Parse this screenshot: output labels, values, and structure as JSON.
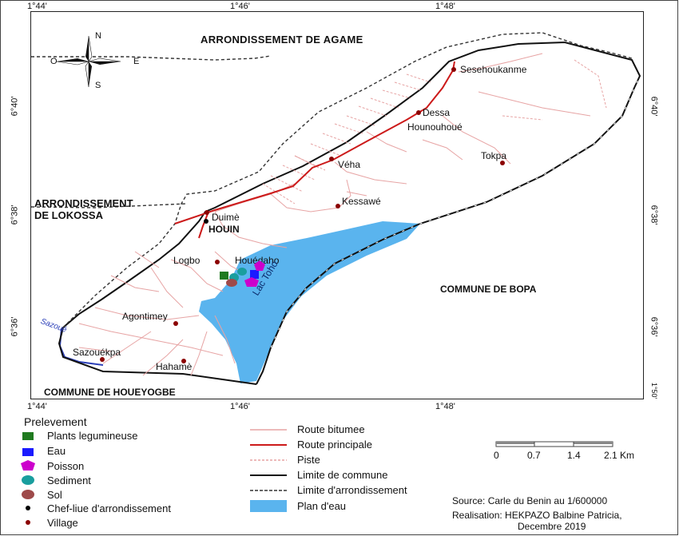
{
  "coords": {
    "top": [
      "1°44'",
      "1°46'",
      "1°48'"
    ],
    "bottom": [
      "1°44'",
      "1°46'",
      "1°48'"
    ],
    "left": [
      "6°40'",
      "6°38'",
      "6°36'"
    ],
    "right": [
      "6°40'",
      "6°38'",
      "6°36'"
    ],
    "corner_right_bottom": "1°50'"
  },
  "compass": {
    "n": "N",
    "s": "S",
    "e": "E",
    "w": "O"
  },
  "regions": {
    "agame": "ARRONDISSEMENT DE AGAME",
    "lokossa_1": "ARRONDISSEMENT",
    "lokossa_2": "DE LOKOSSA",
    "bopa": "COMMUNE DE BOPA",
    "houeyogbe": "COMMUNE DE HOUEYOGBE"
  },
  "places": {
    "sesehoukanme": "Sesehoukanme",
    "dessa": "Dessa",
    "hounouhoue": "Hounouhoué",
    "tokpa": "Tokpa",
    "veha": "Véha",
    "kessawe": "Kessawé",
    "duime": "Duimè",
    "houin": "HOUIN",
    "logbo": "Logbo",
    "houedaho": "Houédaho",
    "agontimey": "Agontimey",
    "sazouekpa": "Sazouékpa",
    "hahame": "Hahamè",
    "lac_toho": "Lac Toho",
    "sazoue": "Sazoué"
  },
  "legend_left": {
    "title": "Prelevement",
    "items": [
      {
        "label": "Plants legumineuse",
        "color": "#1f7a1f",
        "icon": "square"
      },
      {
        "label": "Eau",
        "color": "#1a1aff",
        "icon": "square"
      },
      {
        "label": "Poisson",
        "color": "#cc00cc",
        "icon": "pentagon"
      },
      {
        "label": "Sediment",
        "color": "#1a9e9e",
        "icon": "circle"
      },
      {
        "label": "Sol",
        "color": "#9e4a4a",
        "icon": "circle"
      },
      {
        "label": "Chef-liue d'arrondissement",
        "color": "#000000",
        "icon": "dot"
      },
      {
        "label": "Village",
        "color": "#8b0000",
        "icon": "dot"
      }
    ]
  },
  "legend_mid": {
    "items": [
      {
        "label": "Route bitumee",
        "icon": "line-light"
      },
      {
        "label": "Route principale",
        "icon": "line-red"
      },
      {
        "label": "Piste",
        "icon": "line-dashed-red"
      },
      {
        "label": "Limite de commune",
        "icon": "line-black"
      },
      {
        "label": "Limite d'arrondissement",
        "icon": "line-dashed-black"
      },
      {
        "label": "Plan d'eau",
        "icon": "water"
      }
    ]
  },
  "scale": {
    "ticks": [
      "0",
      "0.7",
      "1.4",
      "2.1 Km"
    ]
  },
  "credits": {
    "source": "Source: Carle du Benin au 1/600000",
    "realisation_1": "Realisation: HEKPAZO Balbine Patricia,",
    "realisation_2": "Decembre 2019"
  },
  "colors": {
    "water": "#5ab4ee",
    "road_main": "#cc1a1a",
    "road_light": "#e8a9a9",
    "boundary": "#111111"
  }
}
